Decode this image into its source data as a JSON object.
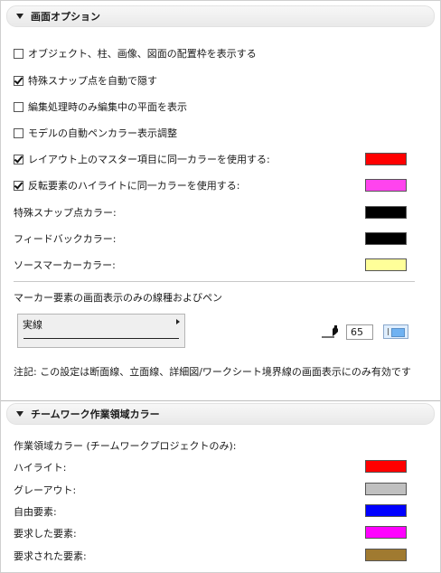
{
  "display_options": {
    "title": "画面オプション",
    "checkbox_items": [
      {
        "label": "オブジェクト、柱、画像、図面の配置枠を表示する",
        "checked": false
      },
      {
        "label": "特殊スナップ点を自動で隠す",
        "checked": true
      },
      {
        "label": "編集処理時のみ編集中の平面を表示",
        "checked": false
      },
      {
        "label": "モデルの自動ペンカラー表示調整",
        "checked": false
      },
      {
        "label": "レイアウト上のマスター項目に同一カラーを使用する:",
        "checked": true,
        "color": "#ff0000"
      },
      {
        "label": "反転要素のハイライトに同一カラーを使用する:",
        "checked": true,
        "color": "#ff44ee"
      }
    ],
    "color_items": [
      {
        "label": "特殊スナップ点カラー:",
        "color": "#000000"
      },
      {
        "label": "フィードバックカラー:",
        "color": "#000000"
      },
      {
        "label": "ソースマーカーカラー:",
        "color": "#ffff99"
      }
    ],
    "marker_label": "マーカー要素の画面表示のみの線種およびペン",
    "line_type": "実線",
    "pen_number": "65",
    "note": "注記: この設定は断面線、立面線、詳細図/ワークシート境界線の画面表示にのみ有効です"
  },
  "teamwork": {
    "title": "チームワーク作業領域カラー",
    "subtitle": "作業領域カラー (チームワークプロジェクトのみ):",
    "items": [
      {
        "label": "ハイライト:",
        "color": "#ff0000"
      },
      {
        "label": "グレーアウト:",
        "color": "#c0c0c0"
      },
      {
        "label": "自由要素:",
        "color": "#0000ff"
      },
      {
        "label": "要求した要素:",
        "color": "#ff00ff"
      },
      {
        "label": "要求された要素:",
        "color": "#a07a30"
      }
    ]
  }
}
